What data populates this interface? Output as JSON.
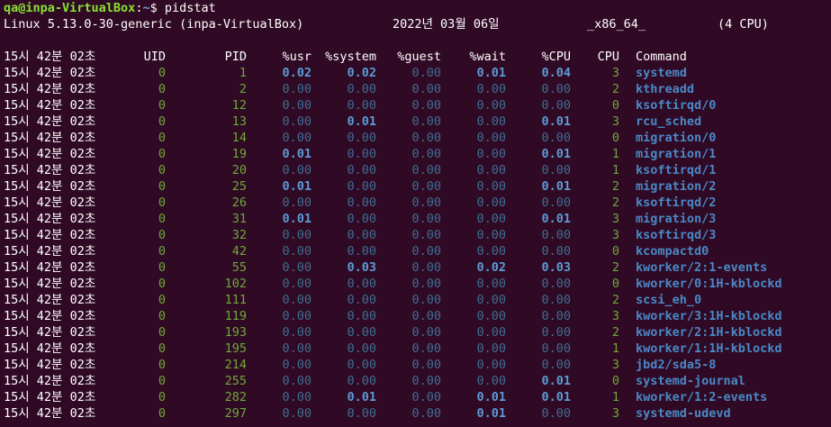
{
  "prompt": {
    "user_host": "qa@inpa-VirtualBox",
    "separator": ":",
    "path": "~",
    "symbol": "$",
    "command": "pidstat"
  },
  "sysinfo": {
    "kernel": "Linux 5.13.0-30-generic (inpa-VirtualBox)",
    "date": "2022년 03월 06일",
    "arch": "_x86_64_",
    "cpus": "(4 CPU)"
  },
  "header": {
    "time": "15시 42분 02초",
    "uid": "UID",
    "pid": "PID",
    "usr": "%usr",
    "system": "%system",
    "guest": "%guest",
    "wait": "%wait",
    "cpu_pct": "%CPU",
    "cpu": "CPU",
    "command": "Command"
  },
  "rows": [
    {
      "time": "15시 42분 02초",
      "uid": "0",
      "pid": "1",
      "usr": "0.02",
      "system": "0.02",
      "guest": "0.00",
      "wait": "0.01",
      "cpu_pct": "0.04",
      "cpu": "3",
      "command": "systemd"
    },
    {
      "time": "15시 42분 02초",
      "uid": "0",
      "pid": "2",
      "usr": "0.00",
      "system": "0.00",
      "guest": "0.00",
      "wait": "0.00",
      "cpu_pct": "0.00",
      "cpu": "2",
      "command": "kthreadd"
    },
    {
      "time": "15시 42분 02초",
      "uid": "0",
      "pid": "12",
      "usr": "0.00",
      "system": "0.00",
      "guest": "0.00",
      "wait": "0.00",
      "cpu_pct": "0.00",
      "cpu": "0",
      "command": "ksoftirqd/0"
    },
    {
      "time": "15시 42분 02초",
      "uid": "0",
      "pid": "13",
      "usr": "0.00",
      "system": "0.01",
      "guest": "0.00",
      "wait": "0.00",
      "cpu_pct": "0.01",
      "cpu": "3",
      "command": "rcu_sched"
    },
    {
      "time": "15시 42분 02초",
      "uid": "0",
      "pid": "14",
      "usr": "0.00",
      "system": "0.00",
      "guest": "0.00",
      "wait": "0.00",
      "cpu_pct": "0.00",
      "cpu": "0",
      "command": "migration/0"
    },
    {
      "time": "15시 42분 02초",
      "uid": "0",
      "pid": "19",
      "usr": "0.01",
      "system": "0.00",
      "guest": "0.00",
      "wait": "0.00",
      "cpu_pct": "0.01",
      "cpu": "1",
      "command": "migration/1"
    },
    {
      "time": "15시 42분 02초",
      "uid": "0",
      "pid": "20",
      "usr": "0.00",
      "system": "0.00",
      "guest": "0.00",
      "wait": "0.00",
      "cpu_pct": "0.00",
      "cpu": "1",
      "command": "ksoftirqd/1"
    },
    {
      "time": "15시 42분 02초",
      "uid": "0",
      "pid": "25",
      "usr": "0.01",
      "system": "0.00",
      "guest": "0.00",
      "wait": "0.00",
      "cpu_pct": "0.01",
      "cpu": "2",
      "command": "migration/2"
    },
    {
      "time": "15시 42분 02초",
      "uid": "0",
      "pid": "26",
      "usr": "0.00",
      "system": "0.00",
      "guest": "0.00",
      "wait": "0.00",
      "cpu_pct": "0.00",
      "cpu": "2",
      "command": "ksoftirqd/2"
    },
    {
      "time": "15시 42분 02초",
      "uid": "0",
      "pid": "31",
      "usr": "0.01",
      "system": "0.00",
      "guest": "0.00",
      "wait": "0.00",
      "cpu_pct": "0.01",
      "cpu": "3",
      "command": "migration/3"
    },
    {
      "time": "15시 42분 02초",
      "uid": "0",
      "pid": "32",
      "usr": "0.00",
      "system": "0.00",
      "guest": "0.00",
      "wait": "0.00",
      "cpu_pct": "0.00",
      "cpu": "3",
      "command": "ksoftirqd/3"
    },
    {
      "time": "15시 42분 02초",
      "uid": "0",
      "pid": "42",
      "usr": "0.00",
      "system": "0.00",
      "guest": "0.00",
      "wait": "0.00",
      "cpu_pct": "0.00",
      "cpu": "0",
      "command": "kcompactd0"
    },
    {
      "time": "15시 42분 02초",
      "uid": "0",
      "pid": "55",
      "usr": "0.00",
      "system": "0.03",
      "guest": "0.00",
      "wait": "0.02",
      "cpu_pct": "0.03",
      "cpu": "2",
      "command": "kworker/2:1-events"
    },
    {
      "time": "15시 42분 02초",
      "uid": "0",
      "pid": "102",
      "usr": "0.00",
      "system": "0.00",
      "guest": "0.00",
      "wait": "0.00",
      "cpu_pct": "0.00",
      "cpu": "0",
      "command": "kworker/0:1H-kblockd"
    },
    {
      "time": "15시 42분 02초",
      "uid": "0",
      "pid": "111",
      "usr": "0.00",
      "system": "0.00",
      "guest": "0.00",
      "wait": "0.00",
      "cpu_pct": "0.00",
      "cpu": "2",
      "command": "scsi_eh_0"
    },
    {
      "time": "15시 42분 02초",
      "uid": "0",
      "pid": "119",
      "usr": "0.00",
      "system": "0.00",
      "guest": "0.00",
      "wait": "0.00",
      "cpu_pct": "0.00",
      "cpu": "3",
      "command": "kworker/3:1H-kblockd"
    },
    {
      "time": "15시 42분 02초",
      "uid": "0",
      "pid": "193",
      "usr": "0.00",
      "system": "0.00",
      "guest": "0.00",
      "wait": "0.00",
      "cpu_pct": "0.00",
      "cpu": "2",
      "command": "kworker/2:1H-kblockd"
    },
    {
      "time": "15시 42분 02초",
      "uid": "0",
      "pid": "195",
      "usr": "0.00",
      "system": "0.00",
      "guest": "0.00",
      "wait": "0.00",
      "cpu_pct": "0.00",
      "cpu": "1",
      "command": "kworker/1:1H-kblockd"
    },
    {
      "time": "15시 42분 02초",
      "uid": "0",
      "pid": "214",
      "usr": "0.00",
      "system": "0.00",
      "guest": "0.00",
      "wait": "0.00",
      "cpu_pct": "0.00",
      "cpu": "3",
      "command": "jbd2/sda5-8"
    },
    {
      "time": "15시 42분 02초",
      "uid": "0",
      "pid": "255",
      "usr": "0.00",
      "system": "0.00",
      "guest": "0.00",
      "wait": "0.00",
      "cpu_pct": "0.01",
      "cpu": "0",
      "command": "systemd-journal"
    },
    {
      "time": "15시 42분 02초",
      "uid": "0",
      "pid": "282",
      "usr": "0.00",
      "system": "0.01",
      "guest": "0.00",
      "wait": "0.01",
      "cpu_pct": "0.01",
      "cpu": "1",
      "command": "kworker/1:2-events"
    },
    {
      "time": "15시 42분 02초",
      "uid": "0",
      "pid": "297",
      "usr": "0.00",
      "system": "0.00",
      "guest": "0.00",
      "wait": "0.01",
      "cpu_pct": "0.00",
      "cpu": "3",
      "command": "systemd-udevd"
    }
  ],
  "colors": {
    "background": "#300a24",
    "prompt_user": "#8ae234",
    "prompt_path": "#729fcf",
    "uid_pid": "#6fa83a",
    "zero_value": "#3d6e93",
    "nonzero_value": "#5b9bd5",
    "command": "#4a88c7"
  }
}
